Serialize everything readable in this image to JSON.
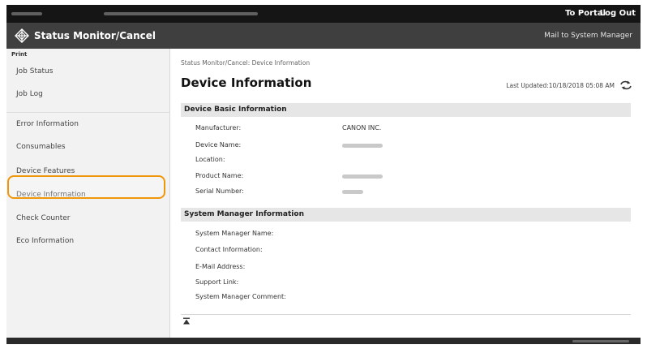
{
  "topbar": {
    "portal_label": "To Portal",
    "logout_label": "Log Out"
  },
  "header": {
    "app_title": "Status Monitor/Cancel",
    "mail_link": "Mail to System Manager",
    "icon": "status-monitor-icon"
  },
  "sidebar": {
    "heading": "Print",
    "items": [
      {
        "label": "Job Status"
      },
      {
        "label": "Job Log"
      },
      {
        "label": "Error Information"
      },
      {
        "label": "Consumables"
      },
      {
        "label": "Device Features"
      },
      {
        "label": "Device Information"
      },
      {
        "label": "Check Counter"
      },
      {
        "label": "Eco Information"
      }
    ],
    "selected": "Device Information",
    "highlight_color": "#f0960a"
  },
  "main": {
    "breadcrumb": "Status Monitor/Cancel: Device Information",
    "title": "Device Information",
    "last_updated": "Last Updated:10/18/2018 05:08 AM",
    "refresh_icon": "refresh-icon",
    "basic_section": {
      "title": "Device Basic Information",
      "fields": {
        "manufacturer_label": "Manufacturer:",
        "manufacturer_value": "CANON INC.",
        "device_name_label": "Device Name:",
        "location_label": "Location:",
        "product_name_label": "Product Name:",
        "serial_number_label": "Serial Number:"
      }
    },
    "manager_section": {
      "title": "System Manager Information",
      "fields": {
        "manager_name_label": "System Manager Name:",
        "contact_label": "Contact Information:",
        "email_label": "E-Mail Address:",
        "support_label": "Support Link:",
        "comment_label": "System Manager Comment:"
      }
    },
    "top_arrow_icon": "back-to-top-icon"
  },
  "colors": {
    "topbar": "#151515",
    "header": "#3f3f3f",
    "sidebar": "#f2f2f2",
    "section_header": "#e6e6e6"
  }
}
